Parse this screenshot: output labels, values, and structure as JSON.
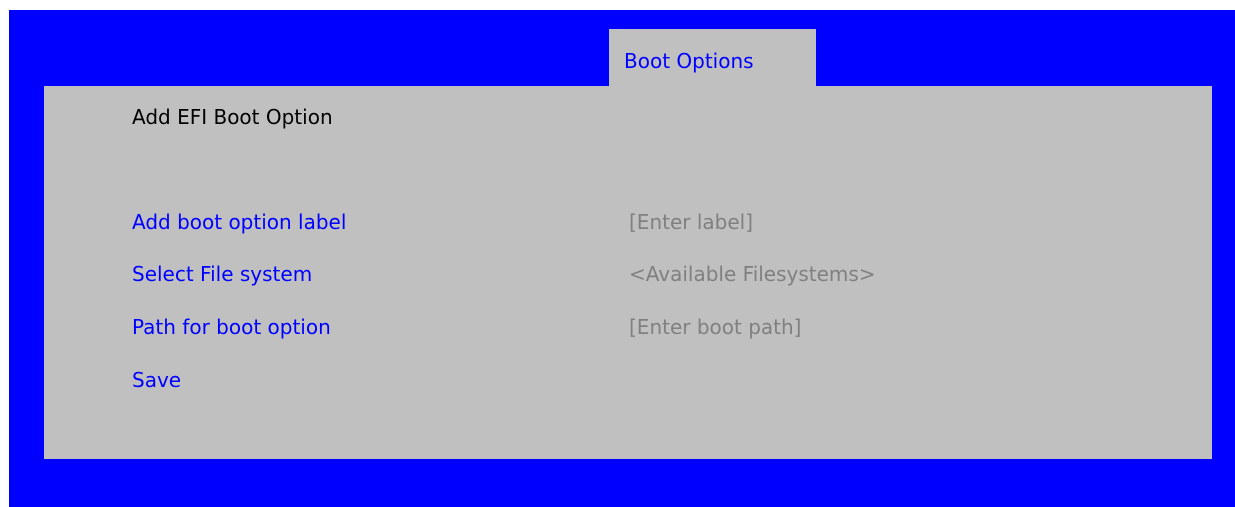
{
  "tab": {
    "label": "Boot Options"
  },
  "page_title": "Add EFI Boot Option",
  "menu": {
    "add_label": {
      "label": "Add boot option label",
      "value": "[Enter label]"
    },
    "select_fs": {
      "label": "Select File system",
      "value": "<Available Filesystems>"
    },
    "boot_path": {
      "label": "Path for boot option",
      "value": "[Enter boot path]"
    },
    "save": {
      "label": "Save"
    }
  },
  "colors": {
    "background": "#0000ff",
    "panel": "#c0c0c0",
    "item_text": "#0000ff",
    "value_text": "#808080",
    "title_text": "#000000"
  }
}
